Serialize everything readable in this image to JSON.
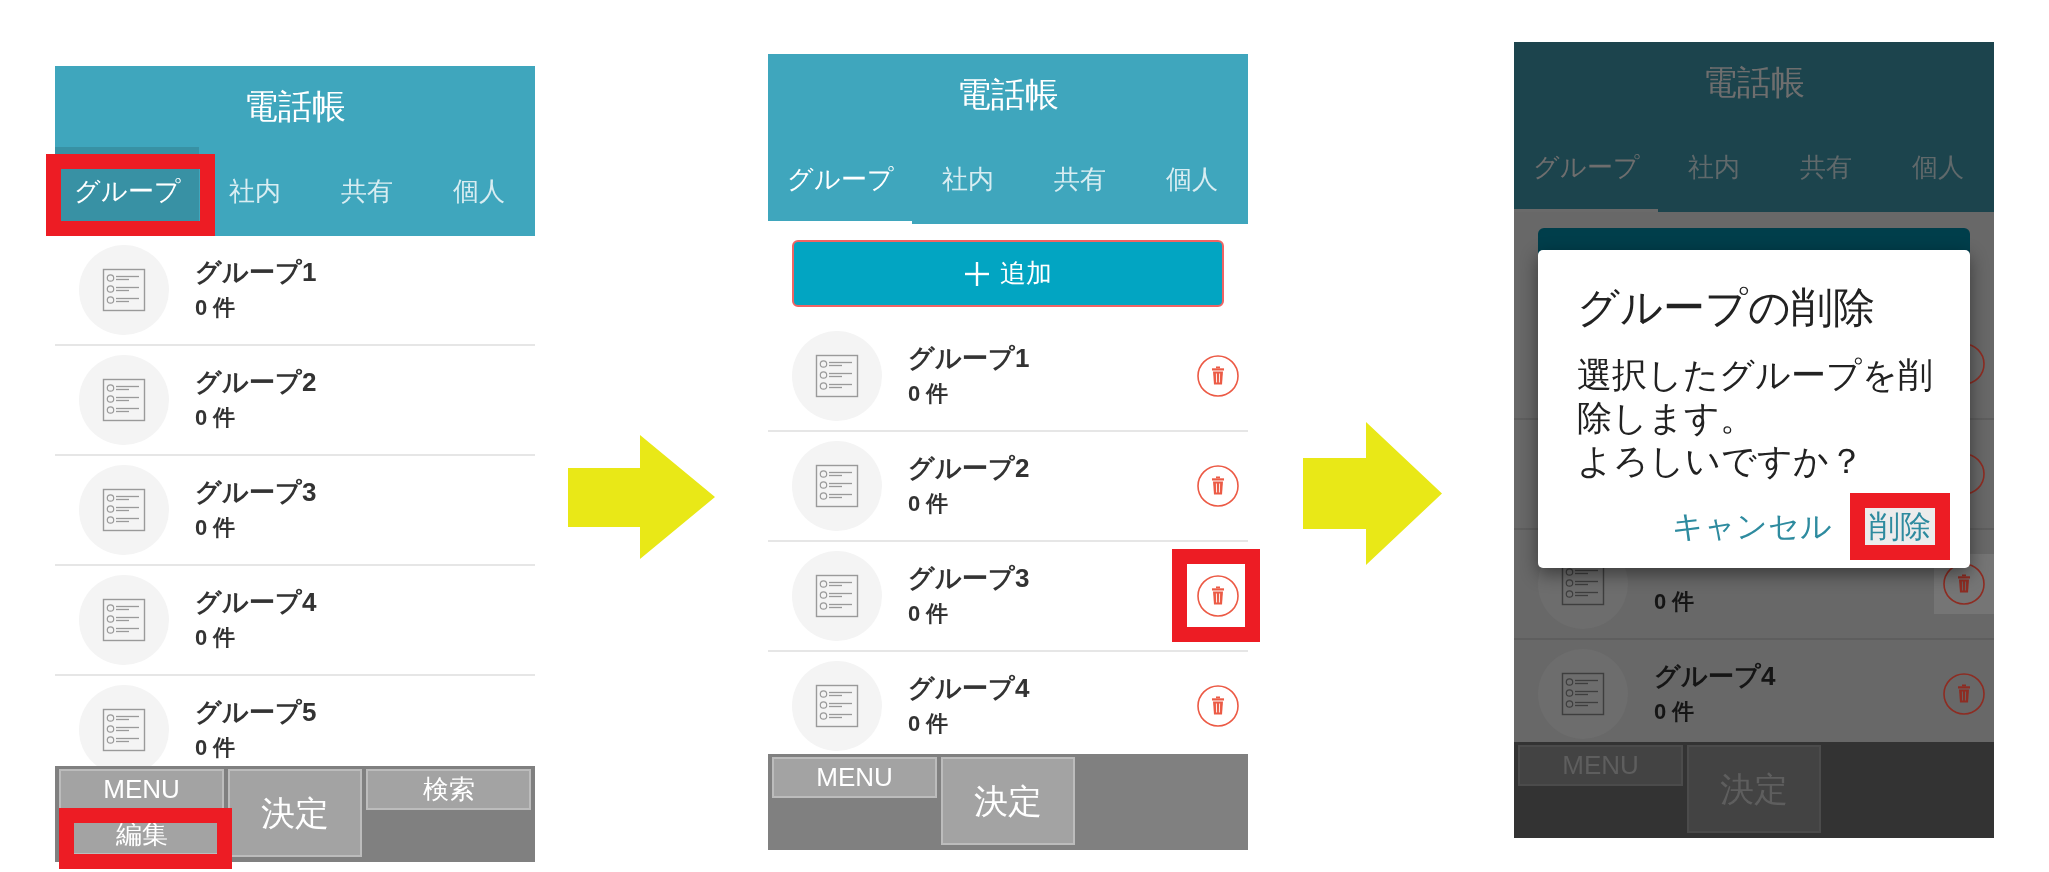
{
  "screens": [
    {
      "kind": "browse",
      "header": {
        "title": "電話帳"
      },
      "tabs": [
        {
          "label": "グループ",
          "selected": true,
          "pressed": true,
          "highlighted": true
        },
        {
          "label": "社内",
          "selected": false,
          "pressed": false,
          "highlighted": false
        },
        {
          "label": "共有",
          "selected": false,
          "pressed": false,
          "highlighted": false
        },
        {
          "label": "個人",
          "selected": false,
          "pressed": false,
          "highlighted": false
        }
      ],
      "rows": [
        {
          "title": "グループ1",
          "count": "0 件"
        },
        {
          "title": "グループ2",
          "count": "0 件"
        },
        {
          "title": "グループ3",
          "count": "0 件"
        },
        {
          "title": "グループ4",
          "count": "0 件"
        },
        {
          "title": "グループ5",
          "count": "0 件"
        }
      ],
      "bottom_bar": {
        "columns": [
          [
            {
              "kind": "small",
              "label": "MENU",
              "highlighted": false
            },
            {
              "kind": "small",
              "label": "編集",
              "highlighted": true
            }
          ],
          [
            {
              "kind": "large",
              "label": "決定",
              "highlighted": false
            }
          ],
          [
            {
              "kind": "small",
              "label": "検索",
              "highlighted": false
            }
          ]
        ]
      }
    },
    {
      "kind": "edit",
      "header": {
        "title": "電話帳"
      },
      "tabs": [
        {
          "label": "グループ",
          "selected": true
        },
        {
          "label": "社内",
          "selected": false
        },
        {
          "label": "共有",
          "selected": false
        },
        {
          "label": "個人",
          "selected": false
        }
      ],
      "add_button": {
        "label": "追加"
      },
      "rows": [
        {
          "title": "グループ1",
          "count": "0 件",
          "trash": {
            "highlighted": false
          }
        },
        {
          "title": "グループ2",
          "count": "0 件",
          "trash": {
            "highlighted": false
          }
        },
        {
          "title": "グループ3",
          "count": "0 件",
          "trash": {
            "highlighted": true
          }
        },
        {
          "title": "グループ4",
          "count": "0 件",
          "trash": {
            "highlighted": false
          }
        }
      ],
      "bottom_bar": {
        "columns": [
          [
            {
              "kind": "small",
              "label": "MENU"
            }
          ],
          [
            {
              "kind": "large",
              "label": "決定"
            }
          ]
        ]
      }
    },
    {
      "kind": "edit",
      "dimmed": true,
      "header": {
        "title": "電話帳"
      },
      "tabs": [
        {
          "label": "グループ",
          "selected": true
        },
        {
          "label": "社内",
          "selected": false
        },
        {
          "label": "共有",
          "selected": false
        },
        {
          "label": "個人",
          "selected": false
        }
      ],
      "rows": [
        {
          "trash": {
            "pressed": false
          }
        },
        {
          "trash": {
            "pressed": false
          }
        },
        {
          "count": "0 件",
          "trash": {
            "pressed": true
          }
        },
        {
          "title": "グループ4",
          "count": "0 件",
          "trash": {
            "pressed": false
          }
        }
      ],
      "bottom_bar": {
        "columns": [
          [
            {
              "kind": "small",
              "label": "MENU"
            }
          ],
          [
            {
              "kind": "large",
              "label": "決定"
            }
          ]
        ]
      },
      "dialog": {
        "title": "グループの削除",
        "message_lines": [
          "選択したグループを削除します。",
          "よろしいですか？"
        ],
        "buttons": [
          {
            "label": "キャンセル",
            "pressed": false,
            "highlighted": false
          },
          {
            "label": "削除",
            "pressed": true,
            "highlighted": true
          }
        ]
      }
    }
  ]
}
